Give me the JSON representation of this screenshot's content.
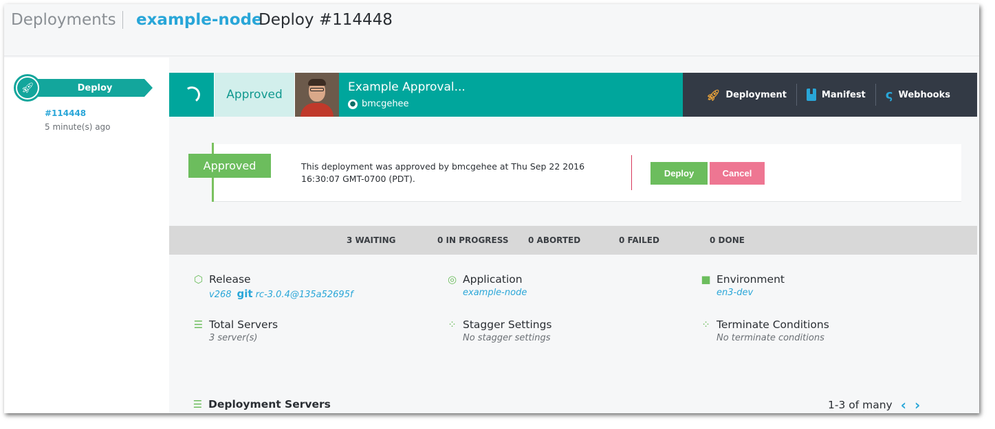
{
  "header": {
    "breadcrumb": "Deployments",
    "app_name": "example-node",
    "deploy_title": "Deploy #114448"
  },
  "sidebar": {
    "stage_label": "Deploy",
    "deploy_number": "#114448",
    "time_ago": "5 minute(s) ago"
  },
  "topbar": {
    "status": "Approved",
    "approval_title": "Example Approval...",
    "approval_user": "bmcgehee",
    "nav": [
      {
        "label": "Deployment",
        "icon": "rocket-icon"
      },
      {
        "label": "Manifest",
        "icon": "manifest-icon"
      },
      {
        "label": "Webhooks",
        "icon": "webhook-icon"
      }
    ]
  },
  "approval_card": {
    "badge": "Approved",
    "message": "This deployment was approved by bmcgehee at Thu Sep 22 2016 16:30:07 GMT-0700 (PDT).",
    "deploy_button": "Deploy",
    "cancel_button": "Cancel"
  },
  "status_counts": [
    "3 WAITING",
    "0 IN PROGRESS",
    "0 ABORTED",
    "0 FAILED",
    "0 DONE"
  ],
  "info": {
    "release": {
      "label": "Release",
      "version": "v268",
      "git_label": "git",
      "git_ref": "rc-3.0.4@135a52695f"
    },
    "application": {
      "label": "Application",
      "value": "example-node"
    },
    "environment": {
      "label": "Environment",
      "value": "en3-dev"
    },
    "total_servers": {
      "label": "Total Servers",
      "value": "3 server(s)"
    },
    "stagger": {
      "label": "Stagger Settings",
      "value": "No stagger settings"
    },
    "terminate": {
      "label": "Terminate Conditions",
      "value": "No terminate conditions"
    }
  },
  "servers": {
    "title": "Deployment Servers",
    "pagination": "1-3 of many"
  },
  "colors": {
    "teal": "#00a69c",
    "dark_nav": "#333a45",
    "green": "#6cbd5d",
    "pink": "#ee7692",
    "link_blue": "#29a6d8"
  }
}
